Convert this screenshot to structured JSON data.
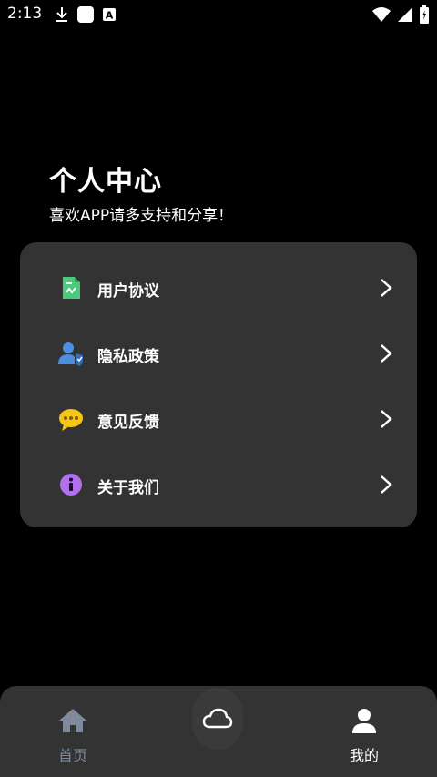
{
  "status_bar": {
    "time": "2:13"
  },
  "header": {
    "title": "个人中心",
    "subtitle": "喜欢APP请多支持和分享！"
  },
  "menu": [
    {
      "label": "用户协议",
      "icon": "document-icon",
      "color": "#4cc97a"
    },
    {
      "label": "隐私政策",
      "icon": "user-shield-icon",
      "color": "#4a90e2"
    },
    {
      "label": "意见反馈",
      "icon": "chat-bubble-icon",
      "color": "#f5c518"
    },
    {
      "label": "关于我们",
      "icon": "info-icon",
      "color": "#b36ff0"
    }
  ],
  "tabbar": {
    "home": {
      "label": "首页",
      "color": "#7f8a9c"
    },
    "center": {
      "icon": "cloud-icon"
    },
    "mine": {
      "label": "我的",
      "color": "#ffffff"
    }
  }
}
